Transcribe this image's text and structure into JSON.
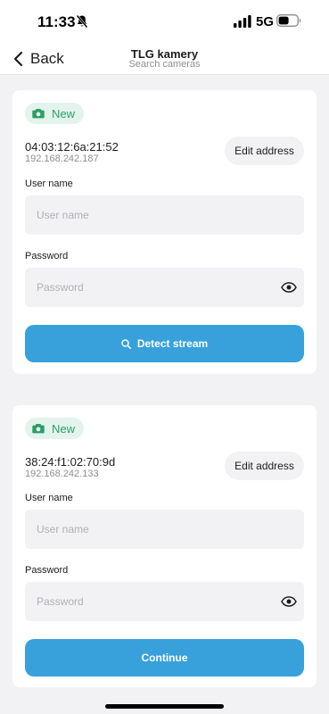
{
  "status_bar": {
    "time": "11:33",
    "network": "5G"
  },
  "nav": {
    "back_label": "Back",
    "title": "TLG kamery",
    "subtitle": "Search cameras"
  },
  "cameras": [
    {
      "badge": "New",
      "mac": "04:03:12:6a:21:52",
      "ip": "192.168.242.187",
      "edit_label": "Edit address",
      "username_label": "User name",
      "username_placeholder": "User name",
      "password_label": "Password",
      "password_placeholder": "Password",
      "action_label": "Detect stream"
    },
    {
      "badge": "New",
      "mac": "38:24:f1:02:70:9d",
      "ip": "192.168.242.133",
      "edit_label": "Edit address",
      "username_label": "User name",
      "username_placeholder": "User name",
      "password_label": "Password",
      "password_placeholder": "Password",
      "action_label": "Continue"
    }
  ],
  "colors": {
    "accent": "#38a1dc",
    "badge_bg": "#e3f4ec",
    "badge_text": "#2e9d68",
    "field_bg": "#f2f2f4",
    "page_bg": "#f2f2f4"
  }
}
